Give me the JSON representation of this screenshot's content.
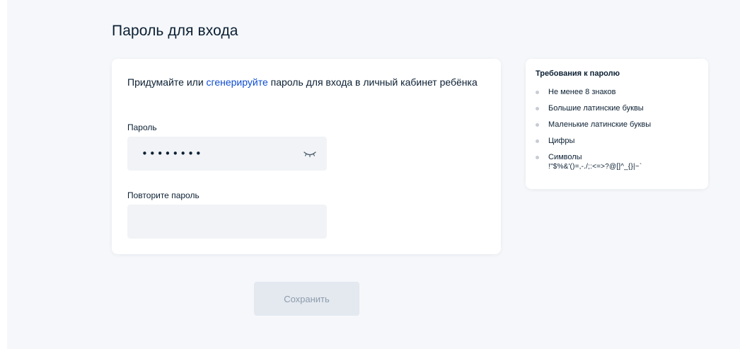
{
  "page": {
    "title": "Пароль для входа"
  },
  "form": {
    "intro_before": "Придумайте или ",
    "intro_link": "сгенерируйте",
    "intro_after": " пароль для входа в личный кабинет ребёнка",
    "password_label": "Пароль",
    "password_value": "••••••••",
    "repeat_label": "Повторите пароль",
    "repeat_value": "",
    "toggle_icon": "eye-closed-icon",
    "save_label": "Сохранить"
  },
  "requirements": {
    "title": "Требования к паролю",
    "items": [
      {
        "label": "Не менее 8 знаков"
      },
      {
        "label": "Большие латинские буквы"
      },
      {
        "label": "Маленькие латинские буквы"
      },
      {
        "label": "Цифры"
      },
      {
        "label": "Символы",
        "detail": "!\"$%&'()=,-./;:<=>?@[]^_{}|~`"
      }
    ]
  },
  "colors": {
    "link": "#0d4cd3",
    "text": "#0b1f33",
    "field_bg": "#f1f3f6",
    "page_bg": "#f5f7fa",
    "button_disabled_bg": "#e4e9f0",
    "button_disabled_text": "#8d9bab",
    "bullet": "#c6ccd4"
  }
}
